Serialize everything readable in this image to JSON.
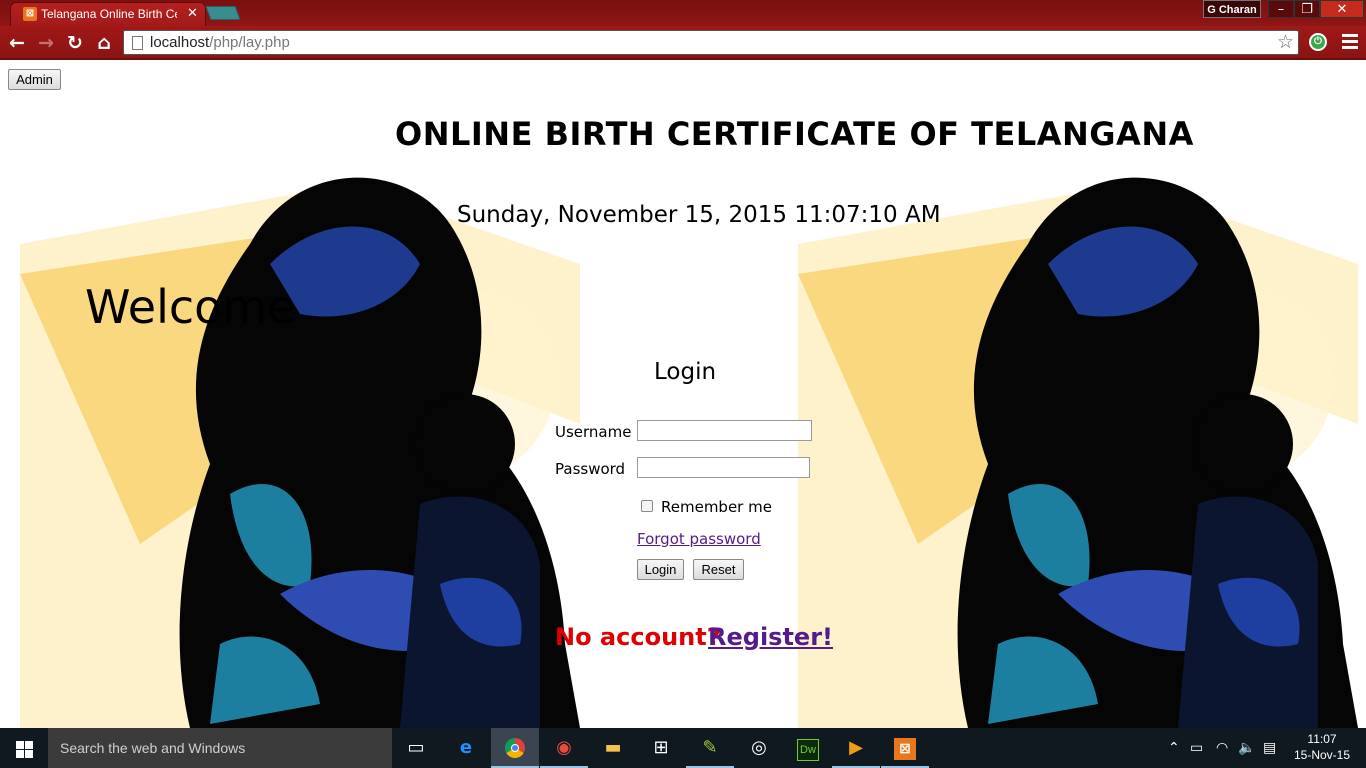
{
  "browser": {
    "tab_title": "Telangana Online Birth Ce",
    "tab_favicon": "xampp-icon",
    "profile_name": "G Charan",
    "url_host": "localhost",
    "url_path": "/php/lay.php",
    "window_controls": {
      "minimize": "–",
      "maximize": "❐",
      "close": "✕"
    }
  },
  "page": {
    "admin_button": "Admin",
    "heading": "ONLINE BIRTH CERTIFICATE OF TELANGANA",
    "datetime": "Sunday, November 15, 2015 11:07:10 AM",
    "welcome": "Welcome",
    "login": {
      "title": "Login",
      "username_label": "Username",
      "username_value": "",
      "password_label": "Password",
      "password_value": "",
      "remember_label": "Remember me",
      "remember_checked": false,
      "forgot_link": "Forgot password",
      "login_button": "Login",
      "reset_button": "Reset"
    },
    "no_account_text": "No account?",
    "register_link": "Register!",
    "colors": {
      "no_account": "#e00000",
      "link": "#551a8b",
      "chrome_red": "#9b1515"
    }
  },
  "taskbar": {
    "search_placeholder": "Search the web and Windows",
    "apps": [
      "task-view-icon",
      "edge-icon",
      "chrome-icon",
      "app-icon",
      "file-explorer-icon",
      "store-icon",
      "notepad-icon",
      "media-icon",
      "dreamweaver-icon",
      "player-icon",
      "xampp-icon"
    ],
    "dreamweaver_label": "Dw",
    "time": "11:07",
    "date": "15-Nov-15"
  }
}
